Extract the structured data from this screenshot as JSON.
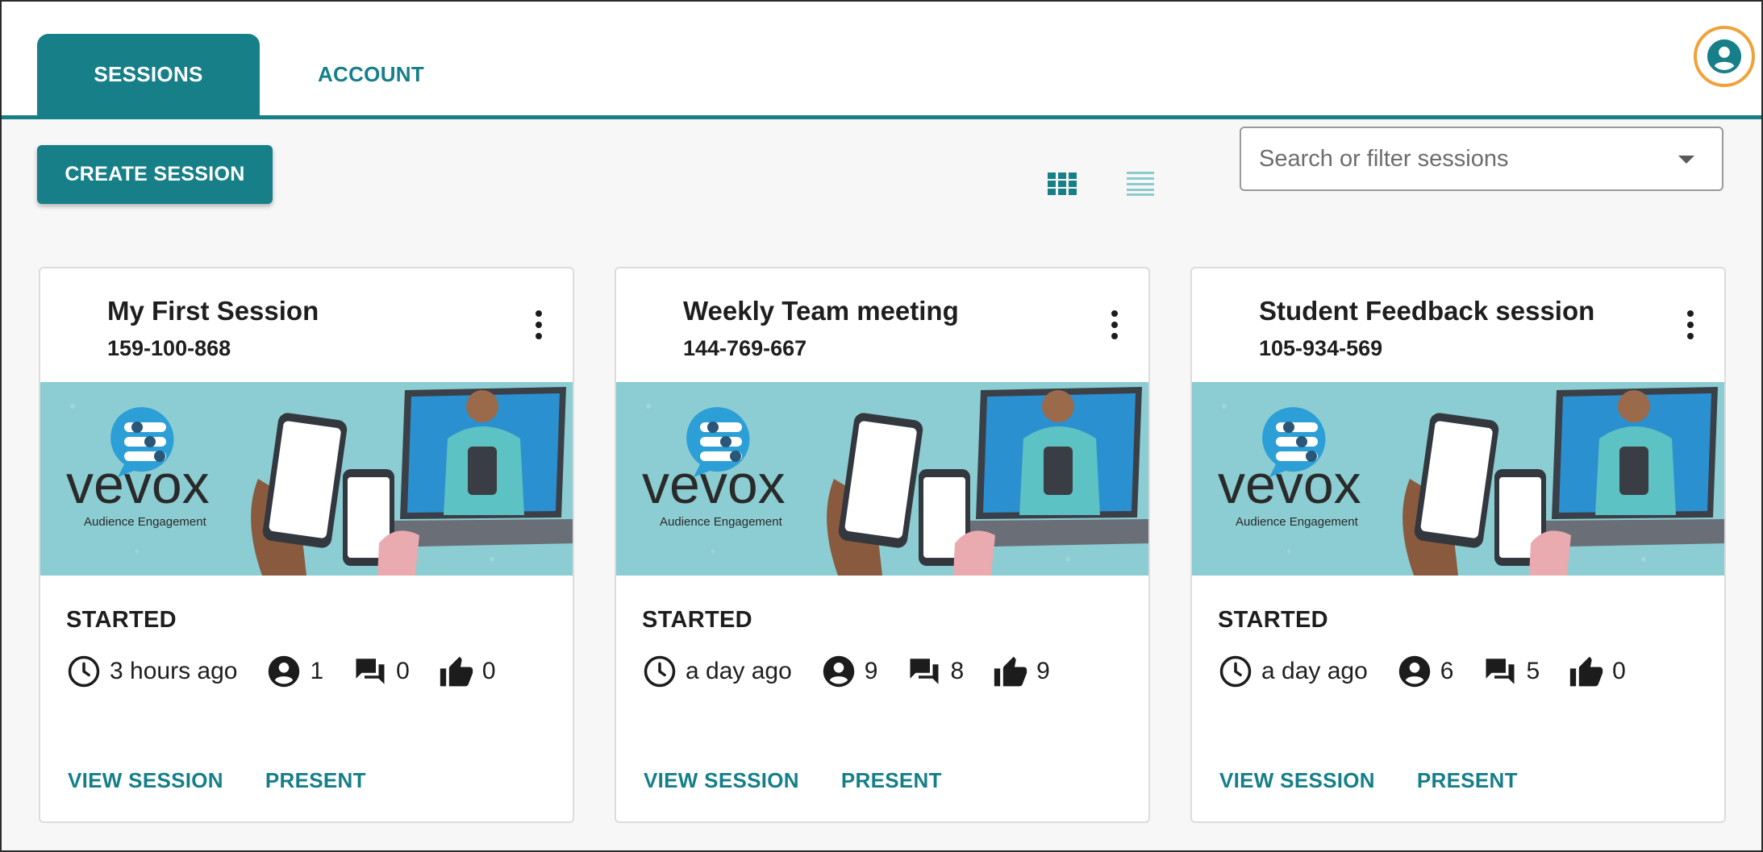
{
  "tabs": {
    "sessions": "SESSIONS",
    "account": "ACCOUNT"
  },
  "toolbar": {
    "create_label": "CREATE SESSION",
    "search_placeholder": "Search or filter sessions"
  },
  "banner": {
    "brand": "vevox",
    "tagline": "Audience Engagement"
  },
  "sessions": [
    {
      "title": "My First Session",
      "code": "159-100-868",
      "status": "STARTED",
      "time": "3 hours ago",
      "participants": "1",
      "comments": "0",
      "likes": "0",
      "view_label": "VIEW SESSION",
      "present_label": "PRESENT"
    },
    {
      "title": "Weekly Team meeting",
      "code": "144-769-667",
      "status": "STARTED",
      "time": "a day ago",
      "participants": "9",
      "comments": "8",
      "likes": "9",
      "view_label": "VIEW SESSION",
      "present_label": "PRESENT"
    },
    {
      "title": "Student Feedback session",
      "code": "105-934-569",
      "status": "STARTED",
      "time": "a day ago",
      "participants": "6",
      "comments": "5",
      "likes": "0",
      "view_label": "VIEW SESSION",
      "present_label": "PRESENT"
    }
  ],
  "colors": {
    "primary": "#177f88",
    "accent_ring": "#f0a23a",
    "banner_bg": "#8bcdd2"
  },
  "icons": [
    "user-circle-icon",
    "grid-view-icon",
    "list-view-icon",
    "dropdown-caret-icon",
    "more-vert-icon",
    "clock-icon",
    "person-icon",
    "chat-icon",
    "thumbs-up-icon"
  ]
}
